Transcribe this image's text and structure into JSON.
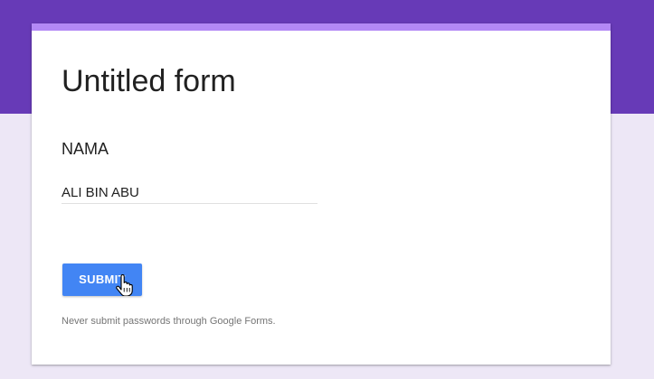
{
  "form": {
    "title": "Untitled form",
    "question_label": "NAMA",
    "answer_value": "ALI BIN ABU",
    "submit_label": "SUBMIT",
    "disclaimer": "Never submit passwords through Google Forms."
  },
  "theme": {
    "header_color": "#673ab7",
    "accent_color": "#b388f5",
    "background_color": "#ede7f6",
    "button_color": "#4285f4"
  },
  "icons": {
    "cursor": "hand-pointer-icon"
  }
}
